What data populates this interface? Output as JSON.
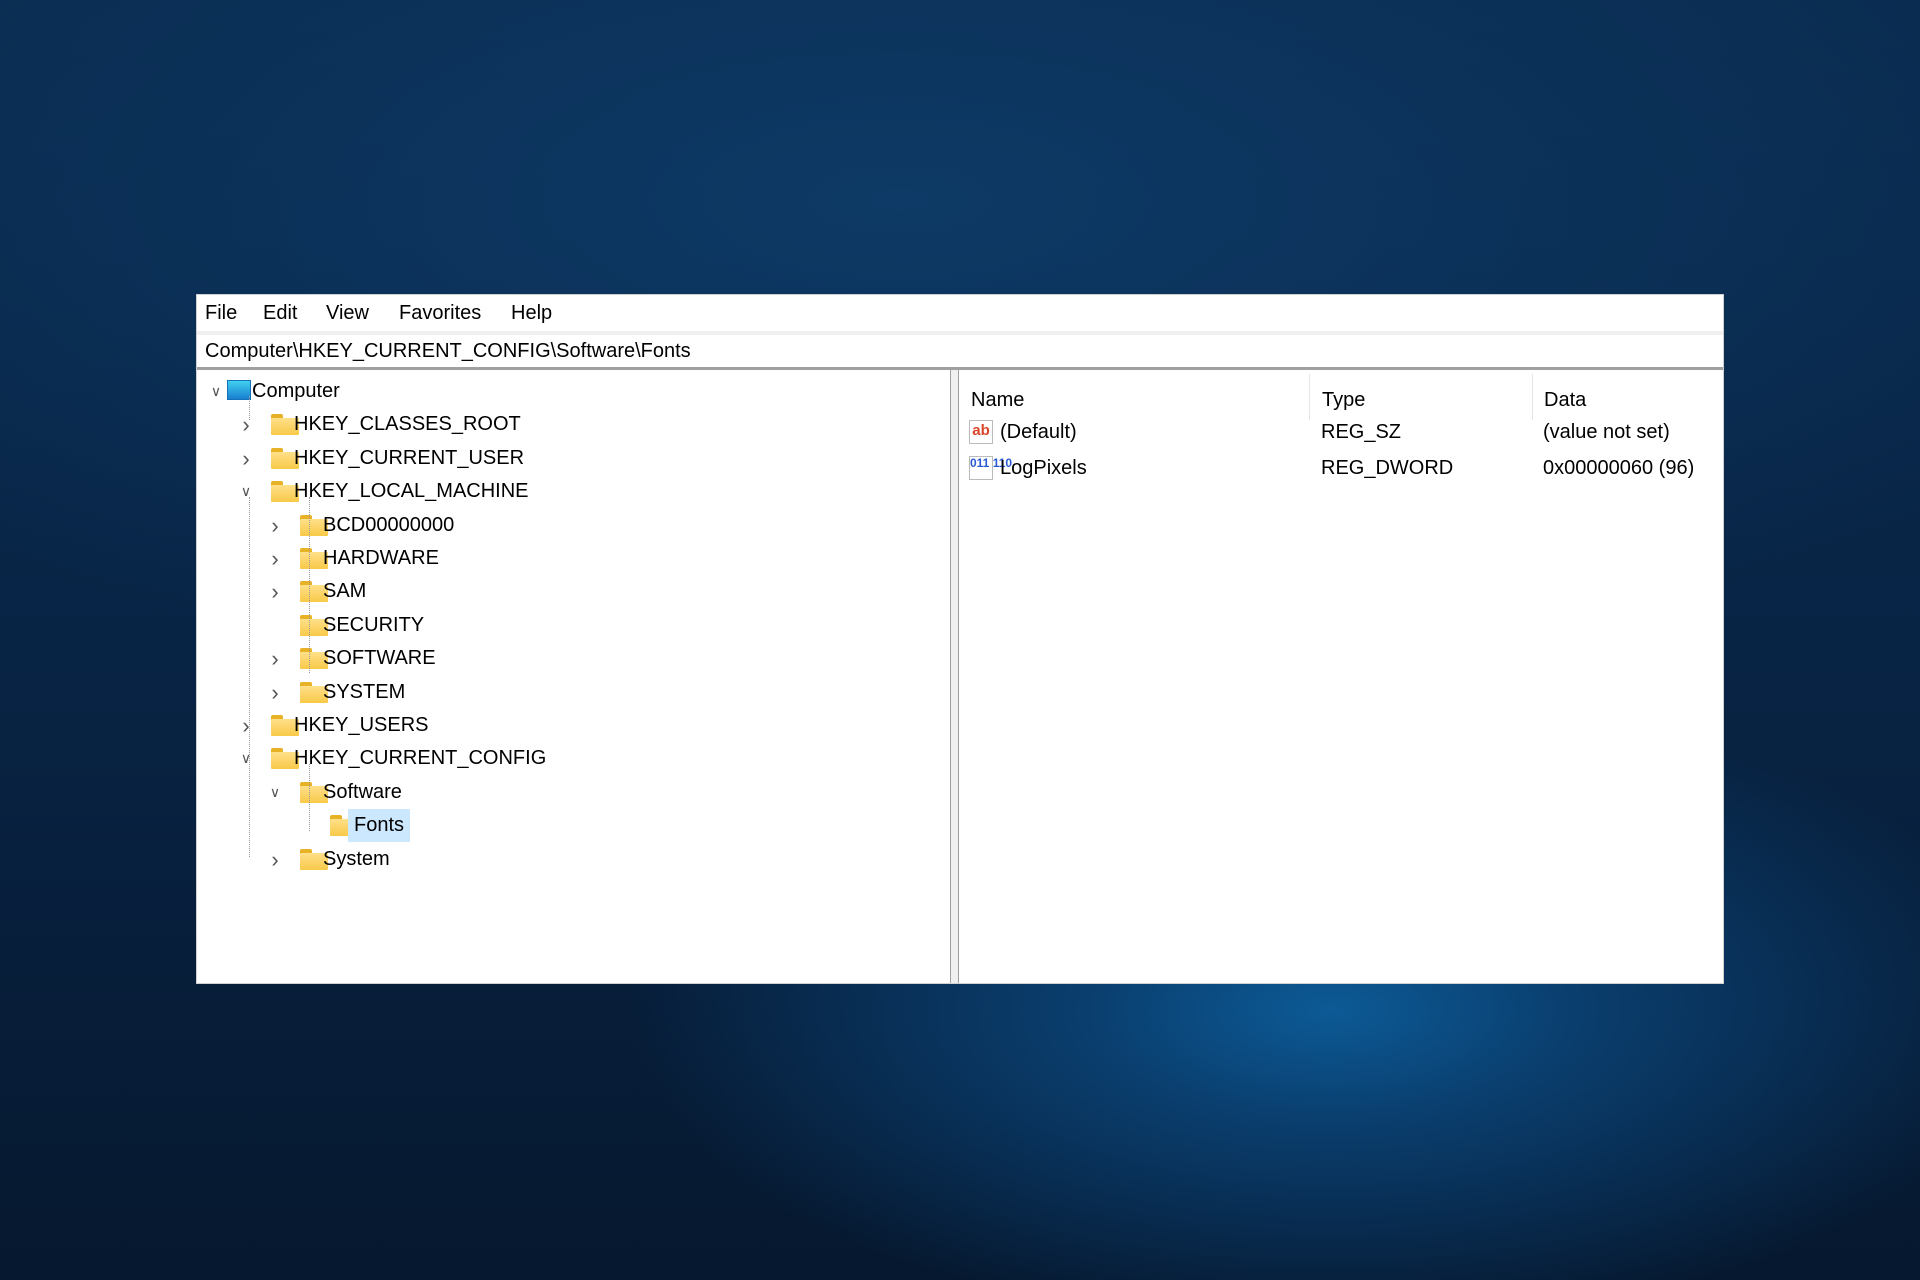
{
  "menu": [
    "File",
    "Edit",
    "View",
    "Favorites",
    "Help"
  ],
  "address": "Computer\\HKEY_CURRENT_CONFIG\\Software\\Fonts",
  "tree": [
    {
      "label": "Computer",
      "level": 0,
      "state": "expanded",
      "icon": "computer-icon"
    },
    {
      "label": "HKEY_CLASSES_ROOT",
      "level": 1,
      "state": "collapsed",
      "icon": "folder-icon"
    },
    {
      "label": "HKEY_CURRENT_USER",
      "level": 1,
      "state": "collapsed",
      "icon": "folder-icon"
    },
    {
      "label": "HKEY_LOCAL_MACHINE",
      "level": 1,
      "state": "expanded",
      "icon": "folder-icon"
    },
    {
      "label": "BCD00000000",
      "level": 2,
      "state": "collapsed",
      "icon": "folder-icon"
    },
    {
      "label": "HARDWARE",
      "level": 2,
      "state": "collapsed",
      "icon": "folder-icon"
    },
    {
      "label": "SAM",
      "level": 2,
      "state": "collapsed",
      "icon": "folder-icon"
    },
    {
      "label": "SECURITY",
      "level": 2,
      "state": "leaf",
      "icon": "folder-icon"
    },
    {
      "label": "SOFTWARE",
      "level": 2,
      "state": "collapsed",
      "icon": "folder-icon"
    },
    {
      "label": "SYSTEM",
      "level": 2,
      "state": "collapsed",
      "icon": "folder-icon"
    },
    {
      "label": "HKEY_USERS",
      "level": 1,
      "state": "collapsed",
      "icon": "folder-icon"
    },
    {
      "label": "HKEY_CURRENT_CONFIG",
      "level": 1,
      "state": "expanded",
      "icon": "folder-icon"
    },
    {
      "label": "Software",
      "level": 2,
      "state": "expanded",
      "icon": "folder-icon"
    },
    {
      "label": "Fonts",
      "level": 3,
      "state": "leaf",
      "icon": "folder-icon",
      "selected": true
    },
    {
      "label": "System",
      "level": 2,
      "state": "collapsed",
      "icon": "folder-icon"
    }
  ],
  "values": {
    "columns": [
      "Name",
      "Type",
      "Data"
    ],
    "rows": [
      {
        "icon": "string-value-icon",
        "icon_text": "ab",
        "name": "(Default)",
        "type": "REG_SZ",
        "data": "(value not set)"
      },
      {
        "icon": "binary-value-icon",
        "icon_text": "011 110",
        "name": "LogPixels",
        "type": "REG_DWORD",
        "data": "0x00000060 (96)"
      }
    ]
  },
  "colors": {
    "selection": "#cce8ff",
    "folder": "#f8c948",
    "string_icon": "#d9452b",
    "binary_icon": "#2a5bd7"
  }
}
